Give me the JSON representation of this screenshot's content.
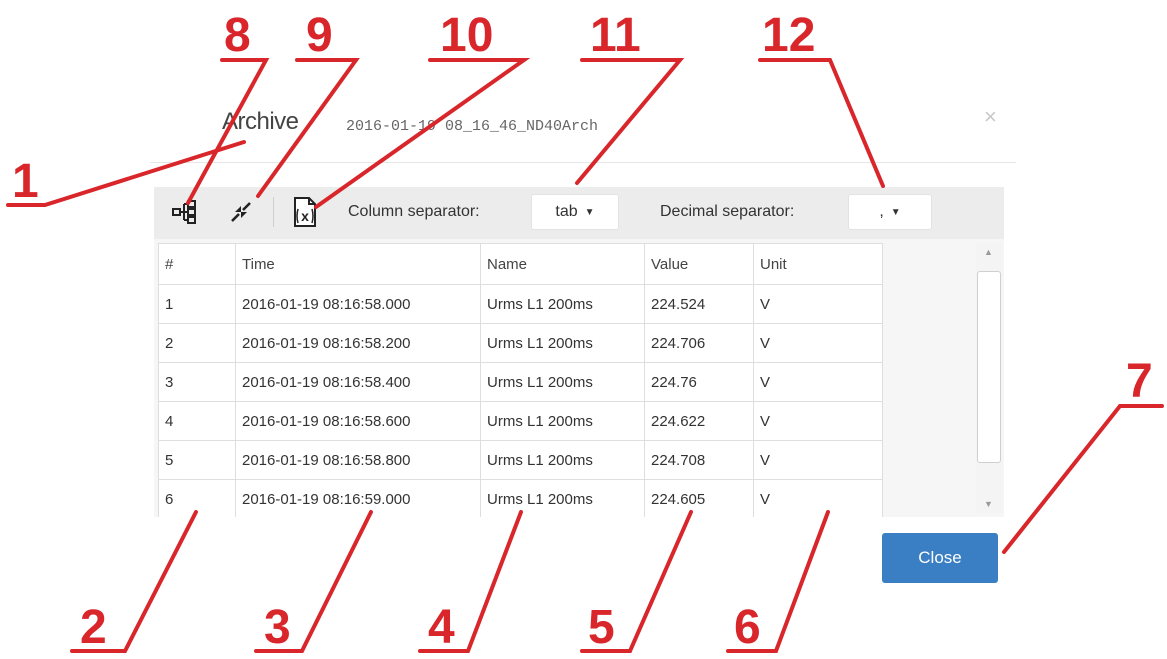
{
  "dialog": {
    "title": "Archive",
    "file_name": "2016-01-19 08_16_46_ND40Arch",
    "close_x": "×"
  },
  "toolbar": {
    "tree_icon": "tree-structure-icon",
    "collapse_icon": "collapse-arrows-icon",
    "excel_icon": "excel-export-icon",
    "column_separator_label": "Column separator:",
    "column_separator_value": "tab",
    "decimal_separator_label": "Decimal separator:",
    "decimal_separator_value": ","
  },
  "table": {
    "headers": [
      "#",
      "Time",
      "Name",
      "Value",
      "Unit"
    ],
    "rows": [
      [
        "1",
        "2016-01-19 08:16:58.000",
        "Urms L1 200ms",
        "224.524",
        "V"
      ],
      [
        "2",
        "2016-01-19 08:16:58.200",
        "Urms L1 200ms",
        "224.706",
        "V"
      ],
      [
        "3",
        "2016-01-19 08:16:58.400",
        "Urms L1 200ms",
        "224.76",
        "V"
      ],
      [
        "4",
        "2016-01-19 08:16:58.600",
        "Urms L1 200ms",
        "224.622",
        "V"
      ],
      [
        "5",
        "2016-01-19 08:16:58.800",
        "Urms L1 200ms",
        "224.708",
        "V"
      ],
      [
        "6",
        "2016-01-19 08:16:59.000",
        "Urms L1 200ms",
        "224.605",
        "V"
      ]
    ]
  },
  "close_button": "Close",
  "callouts": [
    "1",
    "2",
    "3",
    "4",
    "5",
    "6",
    "7",
    "8",
    "9",
    "10",
    "11",
    "12"
  ],
  "colors": {
    "callout": "#d8262b",
    "primary_button": "#3a7ec4"
  }
}
